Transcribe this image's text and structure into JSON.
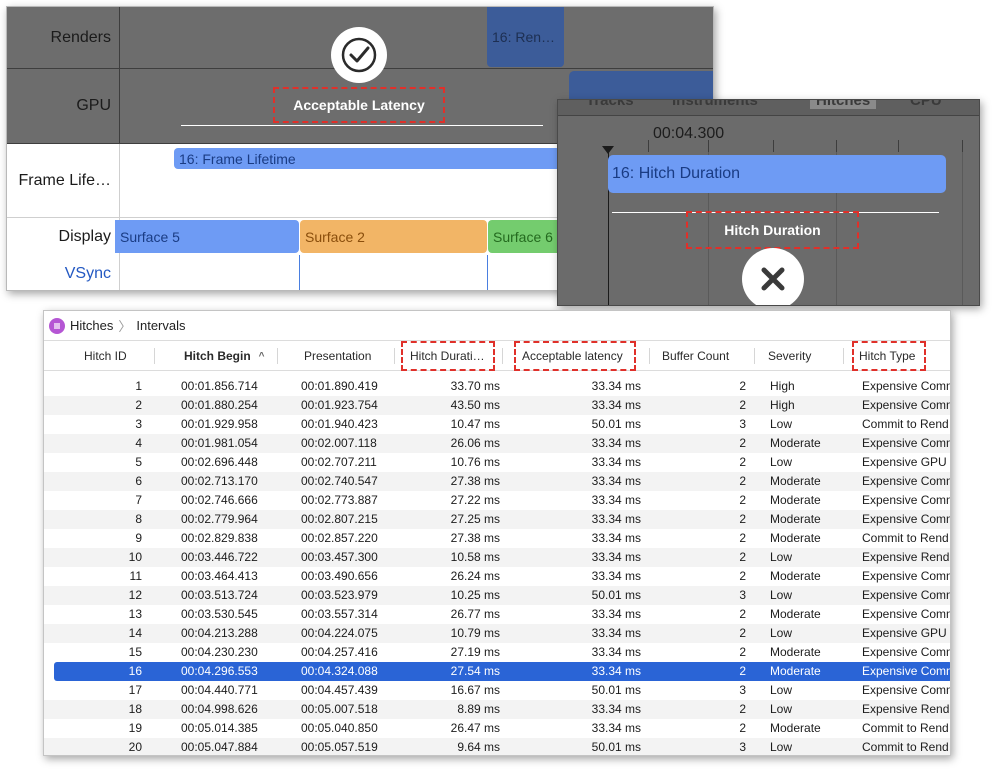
{
  "timeline": {
    "rows": {
      "renders": "Renders",
      "gpu": "GPU",
      "frame_lifetime": "Frame Life…",
      "display": "Display",
      "vsync": "VSync"
    },
    "render_bar": "16: Ren…",
    "lifetime_bar": "16: Frame Lifetime",
    "surfaces": [
      "Surface 5",
      "Surface 2",
      "Surface 6"
    ],
    "callout_acceptable": "Acceptable Latency",
    "icon_check": "checkmark-circle-icon"
  },
  "hitch_panel": {
    "strip_fragments": [
      "Tracks",
      "Instruments",
      "Hitches",
      "CPU"
    ],
    "ruler_time": "00:04.300",
    "hitch_bar": "16: Hitch Duration",
    "callout_hitch": "Hitch Duration",
    "icon_x": "x-circle-icon"
  },
  "table": {
    "breadcrumb": {
      "root": "Hitches",
      "child": "Intervals"
    },
    "columns": {
      "hitch_id": "Hitch ID",
      "hitch_begin": "Hitch Begin",
      "presentation": "Presentation",
      "hitch_duration": "Hitch Durati…",
      "acceptable_latency": "Acceptable latency",
      "buffer_count": "Buffer Count",
      "severity": "Severity",
      "hitch_type": "Hitch Type"
    },
    "sort_indicator": "^",
    "selected_row": 16,
    "rows": [
      {
        "id": "1",
        "begin": "00:01.856.714",
        "pres": "00:01.890.419",
        "dur": "33.70 ms",
        "acc": "33.34 ms",
        "buf": "2",
        "sev": "High",
        "type": "Expensive Comm"
      },
      {
        "id": "2",
        "begin": "00:01.880.254",
        "pres": "00:01.923.754",
        "dur": "43.50 ms",
        "acc": "33.34 ms",
        "buf": "2",
        "sev": "High",
        "type": "Expensive Comm"
      },
      {
        "id": "3",
        "begin": "00:01.929.958",
        "pres": "00:01.940.423",
        "dur": "10.47 ms",
        "acc": "50.01 ms",
        "buf": "3",
        "sev": "Low",
        "type": "Commit to Rend"
      },
      {
        "id": "4",
        "begin": "00:01.981.054",
        "pres": "00:02.007.118",
        "dur": "26.06 ms",
        "acc": "33.34 ms",
        "buf": "2",
        "sev": "Moderate",
        "type": "Expensive Comm"
      },
      {
        "id": "5",
        "begin": "00:02.696.448",
        "pres": "00:02.707.211",
        "dur": "10.76 ms",
        "acc": "33.34 ms",
        "buf": "2",
        "sev": "Low",
        "type": "Expensive GPU"
      },
      {
        "id": "6",
        "begin": "00:02.713.170",
        "pres": "00:02.740.547",
        "dur": "27.38 ms",
        "acc": "33.34 ms",
        "buf": "2",
        "sev": "Moderate",
        "type": "Expensive Comm"
      },
      {
        "id": "7",
        "begin": "00:02.746.666",
        "pres": "00:02.773.887",
        "dur": "27.22 ms",
        "acc": "33.34 ms",
        "buf": "2",
        "sev": "Moderate",
        "type": "Expensive Comm"
      },
      {
        "id": "8",
        "begin": "00:02.779.964",
        "pres": "00:02.807.215",
        "dur": "27.25 ms",
        "acc": "33.34 ms",
        "buf": "2",
        "sev": "Moderate",
        "type": "Expensive Comm"
      },
      {
        "id": "9",
        "begin": "00:02.829.838",
        "pres": "00:02.857.220",
        "dur": "27.38 ms",
        "acc": "33.34 ms",
        "buf": "2",
        "sev": "Moderate",
        "type": "Commit to Rend"
      },
      {
        "id": "10",
        "begin": "00:03.446.722",
        "pres": "00:03.457.300",
        "dur": "10.58 ms",
        "acc": "33.34 ms",
        "buf": "2",
        "sev": "Low",
        "type": "Expensive Rend"
      },
      {
        "id": "11",
        "begin": "00:03.464.413",
        "pres": "00:03.490.656",
        "dur": "26.24 ms",
        "acc": "33.34 ms",
        "buf": "2",
        "sev": "Moderate",
        "type": "Expensive Comm"
      },
      {
        "id": "12",
        "begin": "00:03.513.724",
        "pres": "00:03.523.979",
        "dur": "10.25 ms",
        "acc": "50.01 ms",
        "buf": "3",
        "sev": "Low",
        "type": "Expensive Comm"
      },
      {
        "id": "13",
        "begin": "00:03.530.545",
        "pres": "00:03.557.314",
        "dur": "26.77 ms",
        "acc": "33.34 ms",
        "buf": "2",
        "sev": "Moderate",
        "type": "Expensive Comm"
      },
      {
        "id": "14",
        "begin": "00:04.213.288",
        "pres": "00:04.224.075",
        "dur": "10.79 ms",
        "acc": "33.34 ms",
        "buf": "2",
        "sev": "Low",
        "type": "Expensive GPU"
      },
      {
        "id": "15",
        "begin": "00:04.230.230",
        "pres": "00:04.257.416",
        "dur": "27.19 ms",
        "acc": "33.34 ms",
        "buf": "2",
        "sev": "Moderate",
        "type": "Expensive Comm"
      },
      {
        "id": "16",
        "begin": "00:04.296.553",
        "pres": "00:04.324.088",
        "dur": "27.54 ms",
        "acc": "33.34 ms",
        "buf": "2",
        "sev": "Moderate",
        "type": "Expensive Comm"
      },
      {
        "id": "17",
        "begin": "00:04.440.771",
        "pres": "00:04.457.439",
        "dur": "16.67 ms",
        "acc": "50.01 ms",
        "buf": "3",
        "sev": "Low",
        "type": "Expensive Comm"
      },
      {
        "id": "18",
        "begin": "00:04.998.626",
        "pres": "00:05.007.518",
        "dur": "8.89 ms",
        "acc": "33.34 ms",
        "buf": "2",
        "sev": "Low",
        "type": "Expensive Rend"
      },
      {
        "id": "19",
        "begin": "00:05.014.385",
        "pres": "00:05.040.850",
        "dur": "26.47 ms",
        "acc": "33.34 ms",
        "buf": "2",
        "sev": "Moderate",
        "type": "Commit to Rend"
      },
      {
        "id": "20",
        "begin": "00:05.047.884",
        "pres": "00:05.057.519",
        "dur": "9.64 ms",
        "acc": "50.01 ms",
        "buf": "3",
        "sev": "Low",
        "type": "Commit to Rend"
      }
    ]
  }
}
